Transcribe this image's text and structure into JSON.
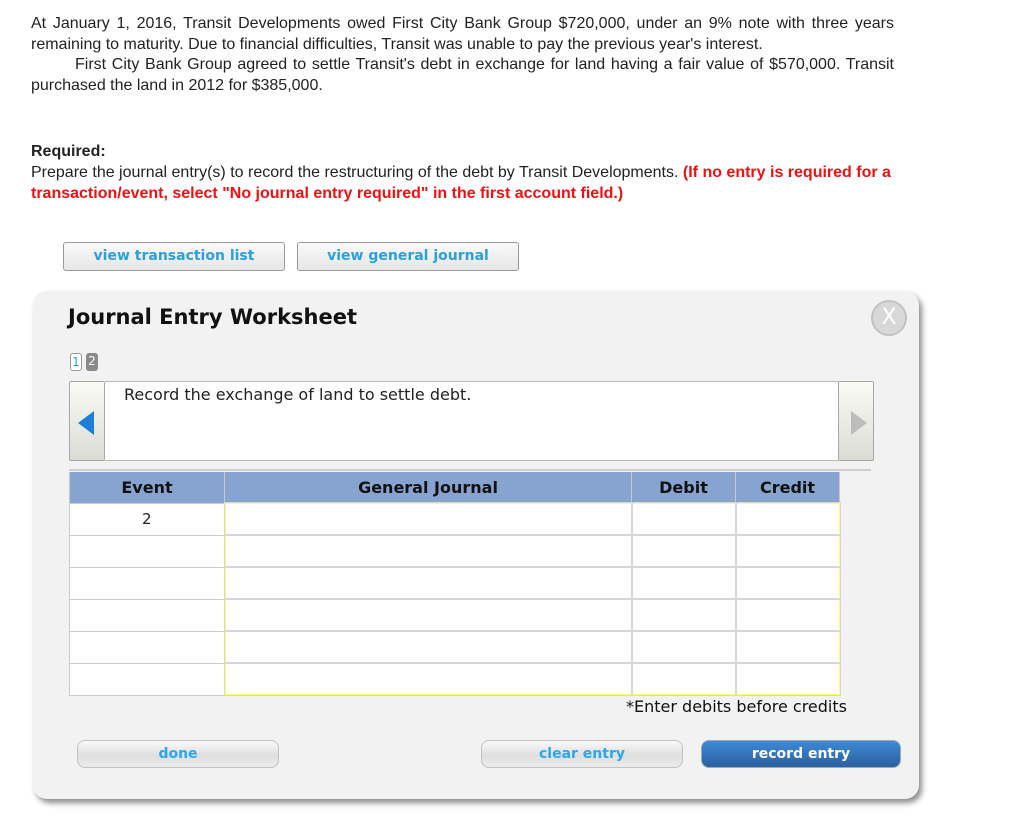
{
  "problem": {
    "paragraph1": "At January 1, 2016, Transit Developments owed First City Bank Group $720,000, under an 9% note with three years remaining to maturity. Due to financial difficulties, Transit was unable to pay the previous year's interest.",
    "paragraph2": "First City Bank Group agreed to settle Transit's debt in exchange for land having a fair value of $570,000. Transit purchased the land in 2012 for $385,000."
  },
  "required": {
    "label": "Required:",
    "text": "Prepare the journal entry(s) to record the restructuring of the debt by Transit Developments.",
    "warning": "(If no entry is required for a transaction/event, select \"No journal entry required\" in the first account field.)"
  },
  "top_buttons": {
    "transaction_list": "view transaction list",
    "general_journal": "view general journal"
  },
  "worksheet": {
    "title": "Journal Entry Worksheet",
    "close_icon": "close-icon",
    "close_glyph": "X",
    "pages": [
      {
        "label": "1",
        "active": true
      },
      {
        "label": "2",
        "active": false
      }
    ],
    "description": "Record the exchange of land to settle debt.",
    "table": {
      "headers": [
        "Event",
        "General Journal",
        "Debit",
        "Credit"
      ],
      "rows": [
        {
          "event": "2",
          "account": "",
          "debit": "",
          "credit": ""
        },
        {
          "event": "",
          "account": "",
          "debit": "",
          "credit": ""
        },
        {
          "event": "",
          "account": "",
          "debit": "",
          "credit": ""
        },
        {
          "event": "",
          "account": "",
          "debit": "",
          "credit": ""
        },
        {
          "event": "",
          "account": "",
          "debit": "",
          "credit": ""
        },
        {
          "event": "",
          "account": "",
          "debit": "",
          "credit": ""
        }
      ]
    },
    "note": "*Enter debits before credits",
    "buttons": {
      "done": "done",
      "clear": "clear entry",
      "record": "record entry"
    }
  },
  "colors": {
    "link_blue": "#29a0e0",
    "warning_red": "#ee1111",
    "header_blue": "#87a4d0",
    "input_highlight": "#ffff66",
    "record_button": "#2a5f9e"
  }
}
